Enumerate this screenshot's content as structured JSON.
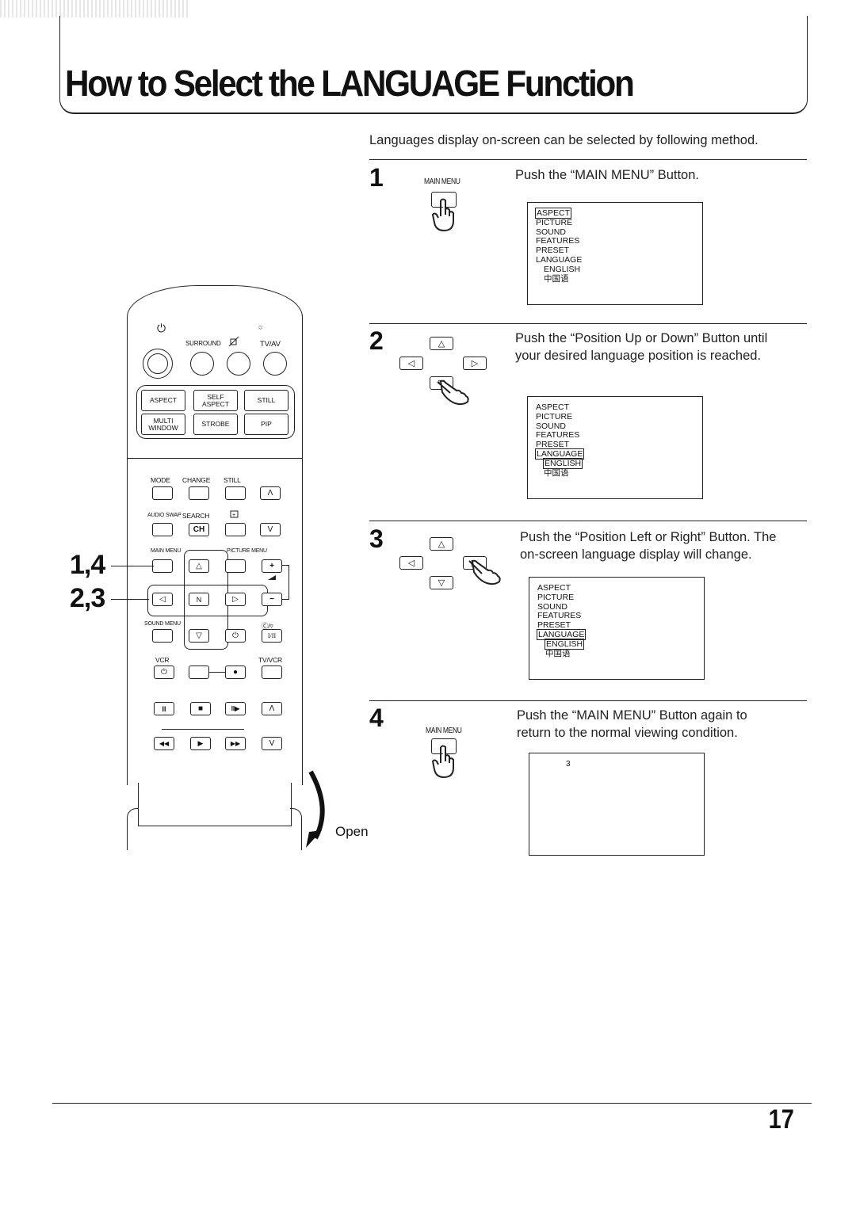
{
  "page": {
    "title": "How to Select the LANGUAGE Function",
    "intro": "Languages display on-screen can be selected by following method.",
    "page_number": "17"
  },
  "steps": [
    {
      "number": "1",
      "button_label": "MAIN MENU",
      "text": "Push the “MAIN MENU” Button.",
      "osd": {
        "items": [
          "ASPECT",
          "PICTURE",
          "SOUND",
          "FEATURES",
          "PRESET",
          "LANGUAGE"
        ],
        "sub_items": [
          "ENGLISH",
          "中国语"
        ],
        "highlighted": "ASPECT"
      }
    },
    {
      "number": "2",
      "text_line1": "Push the “Position Up or Down” Button until",
      "text_line2": "your desired language position is reached.",
      "pressed_key": "down",
      "osd": {
        "items": [
          "ASPECT",
          "PICTURE",
          "SOUND",
          "FEATURES",
          "PRESET",
          "LANGUAGE"
        ],
        "sub_items": [
          "ENGLISH",
          "中国语"
        ],
        "highlighted": "LANGUAGE",
        "selected_sub": "ENGLISH"
      }
    },
    {
      "number": "3",
      "text_line1": "Push the “Position Left or Right” Button. The",
      "text_line2": "on-screen language display will change.",
      "pressed_key": "right",
      "osd": {
        "items": [
          "ASPECT",
          "PICTURE",
          "SOUND",
          "FEATURES",
          "PRESET",
          "LANGUAGE"
        ],
        "sub_items": [
          "ENGLISH",
          "中国语"
        ],
        "highlighted": "LANGUAGE",
        "selected_sub": "ENGLISH"
      }
    },
    {
      "number": "4",
      "button_label": "MAIN MENU",
      "text_line1": "Push the “MAIN MENU” Button again to",
      "text_line2": "return to the normal viewing condition.",
      "osd": {
        "channel": "3"
      }
    }
  ],
  "keys": {
    "up": "△",
    "down": "▽",
    "left": "◁",
    "right": "▷"
  },
  "remote": {
    "top_labels": {
      "power_icon": "⏻",
      "surround": "SURROUND",
      "mute_icon": "mute",
      "indicator": "○",
      "tv_av": "TV/AV"
    },
    "panel_buttons": [
      "ASPECT",
      "SELF ASPECT",
      "STILL",
      "MULTI WINDOW",
      "STROBE",
      "PIP"
    ],
    "row1_labels": [
      "MODE",
      "CHANGE",
      "STILL"
    ],
    "row2_labels": [
      "AUDIO SWAP",
      "SEARCH"
    ],
    "ch_label": "CH",
    "caret_up": "Λ",
    "caret_down": "V",
    "main_menu": "MAIN MENU",
    "picture_menu": "PICTURE MENU",
    "sound_menu": "SOUND MENU",
    "n_label": "N",
    "plus": "+",
    "minus": "−",
    "stereo_label": "Ⓒ/▿",
    "dual_label": "I/II",
    "timer_icon": "⏻",
    "vcr": "VCR",
    "tv_vcr": "TV/VCR",
    "record_icon": "●",
    "pause_icon": "II",
    "stop_icon": "■",
    "slow_icon": "II▶",
    "rewind_icon": "◀◀",
    "play_icon": "▶",
    "ff_icon": "▶▶",
    "callout_1": "1,4",
    "callout_2": "2,3",
    "open_label": "Open"
  }
}
